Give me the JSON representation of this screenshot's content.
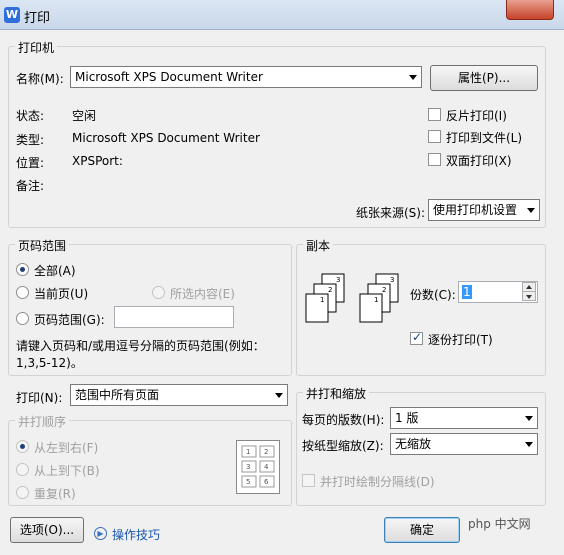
{
  "window": {
    "title": "打印"
  },
  "printer": {
    "group_title": "打印机",
    "name_label": "名称(M):",
    "name_value": "Microsoft XPS Document Writer",
    "properties_button": "属性(P)...",
    "status_label": "状态:",
    "status_value": "空闲",
    "type_label": "类型:",
    "type_value": "Microsoft XPS Document Writer",
    "location_label": "位置:",
    "location_value": "XPSPort:",
    "comment_label": "备注:",
    "reverse_print": "反片打印(I)",
    "print_to_file": "打印到文件(L)",
    "duplex": "双面打印(X)",
    "paper_source_label": "纸张来源(S):",
    "paper_source_value": "使用打印机设置"
  },
  "page_range": {
    "group_title": "页码范围",
    "all": "全部(A)",
    "current": "当前页(U)",
    "selection": "所选内容(E)",
    "pages": "页码范围(G):",
    "pages_value": "",
    "hint_line1": "请键入页码和/或用逗号分隔的页码范围(例如：",
    "hint_line2": "1,3,5-12)。"
  },
  "copies": {
    "group_title": "副本",
    "count_label": "份数(C):",
    "count_value": "1",
    "collate": "逐份打印(T)"
  },
  "print_what": {
    "label": "打印(N):",
    "value": "范围中所有页面"
  },
  "order": {
    "group_title": "并打顺序",
    "left_to_right": "从左到右(F)",
    "top_to_bottom": "从上到下(B)",
    "repeat": "重复(R)"
  },
  "zoom": {
    "group_title": "并打和缩放",
    "pages_per_sheet_label": "每页的版数(H):",
    "pages_per_sheet_value": "1 版",
    "scale_label": "按纸型缩放(Z):",
    "scale_value": "无缩放",
    "draw_borders": "并打时绘制分隔线(D)"
  },
  "footer": {
    "options_button": "选项(O)...",
    "tips_link": "操作技巧",
    "ok_button": "确定",
    "watermark": "php 中文网"
  },
  "colors": {
    "accent": "#3399ff",
    "close": "#c7432a"
  }
}
